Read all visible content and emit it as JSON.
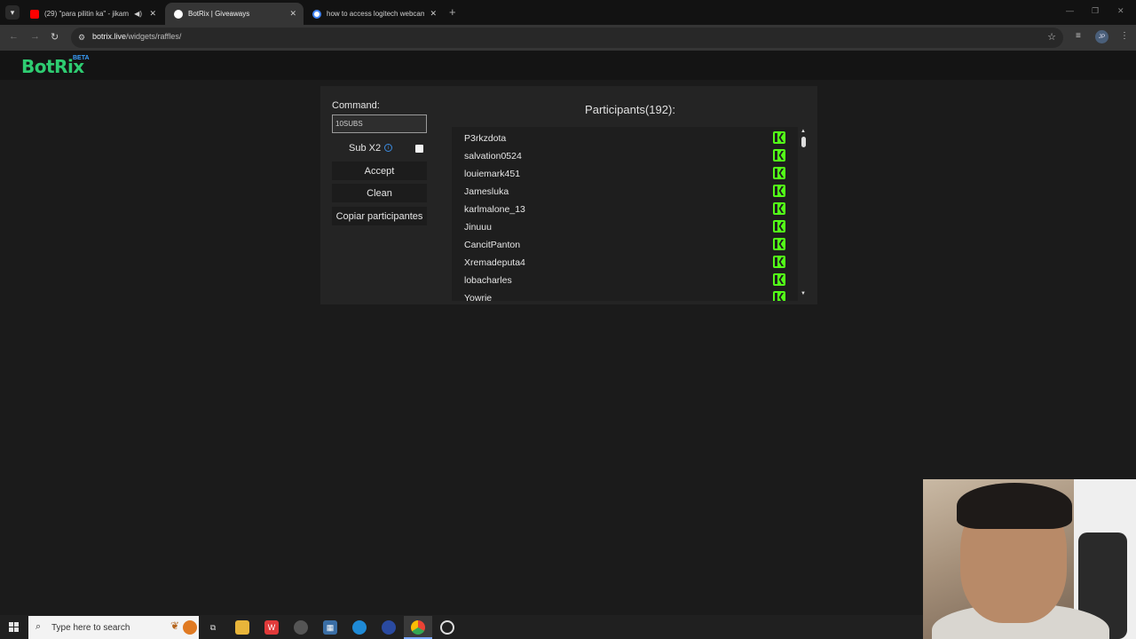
{
  "browser": {
    "tabs": [
      {
        "title": "(29) \"para pilitin ka\" - jikam",
        "favicon": "youtube-favicon",
        "color": "#ff0000"
      },
      {
        "title": "BotRix | Giveaways",
        "favicon": "botrix-favicon",
        "color": "#ffffff"
      },
      {
        "title": "how to access logitech webcam",
        "favicon": "google-favicon",
        "color": "#4285f4"
      }
    ],
    "new_tab": "+",
    "url_host": "botrix.live",
    "url_path": "/widgets/raffles/",
    "profile_initials": "JP"
  },
  "site": {
    "logo": "BotRix",
    "badge": "BETA"
  },
  "raffle": {
    "command_label": "Command:",
    "command_value": "10SUBS",
    "sub_x2_label": "Sub X2",
    "sub_x2_checked": false,
    "accept_label": "Accept",
    "clean_label": "Clean",
    "copy_label": "Copiar participantes",
    "participants_title": "Participants(192):",
    "participants": [
      "P3rkzdota",
      "salvation0524",
      "louiemark451",
      "Jamesluka",
      "karlmalone_13",
      "Jinuuu",
      "CancitPanton",
      "Xremadeputa4",
      "lobacharles",
      "Yowrie"
    ],
    "platform_icon": "kick-icon",
    "platform_color": "#53fc18"
  },
  "taskbar": {
    "search_placeholder": "Type here to search",
    "apps": [
      "task-view-icon",
      "file-explorer-icon",
      "wps-icon",
      "app-icon",
      "calculator-icon",
      "edge-icon",
      "app-icon",
      "chrome-icon",
      "clock-app-icon"
    ]
  }
}
